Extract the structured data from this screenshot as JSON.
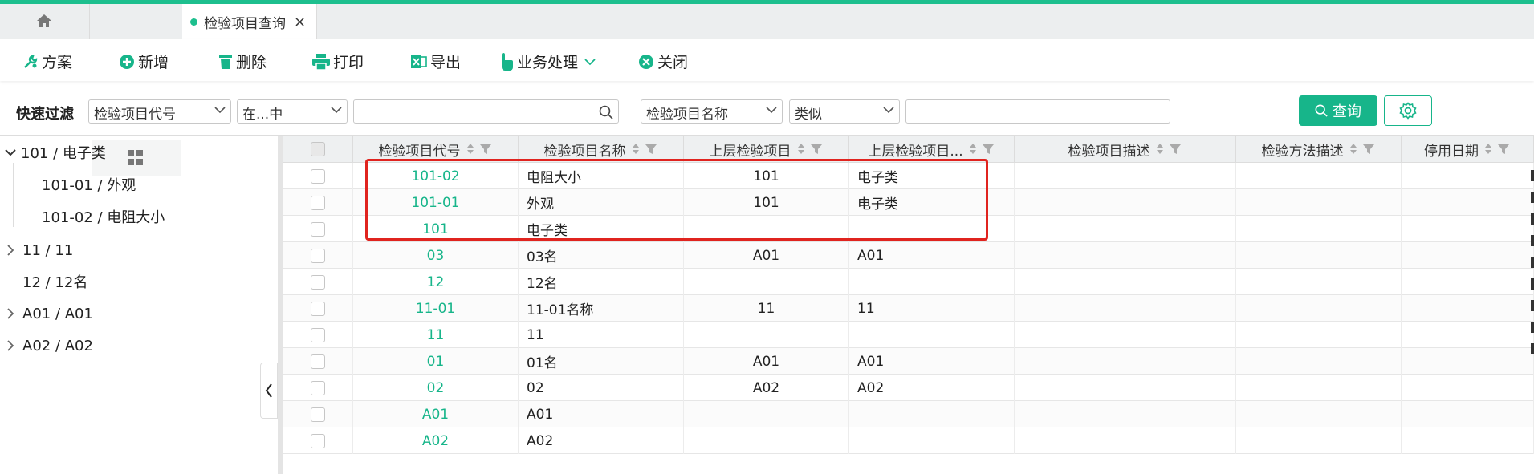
{
  "tabs": [
    {
      "name": "home",
      "label": ""
    },
    {
      "name": "apps",
      "label": ""
    },
    {
      "name": "query",
      "label": "检验项目查询",
      "close": "×"
    }
  ],
  "toolbar": {
    "scheme": "方案",
    "add": "新增",
    "delete": "删除",
    "print": "打印",
    "export": "导出",
    "business": "业务处理",
    "close": "关闭"
  },
  "filter": {
    "label": "快速过滤",
    "field1": "检验项目代号",
    "op1": "在...中",
    "value1": "",
    "field2": "检验项目名称",
    "op2": "类似",
    "value2": "",
    "query": "查询"
  },
  "tree": [
    {
      "label": "101 / 电子类",
      "expanded": true
    },
    {
      "label": "101-01 / 外观"
    },
    {
      "label": "101-02 / 电阻大小"
    },
    {
      "label": "11 / 11",
      "expanded": false
    },
    {
      "label": "12 / 12名"
    },
    {
      "label": "A01 / A01",
      "expanded": false
    },
    {
      "label": "A02 / A02",
      "expanded": false
    }
  ],
  "columns": [
    "检验项目代号",
    "检验项目名称",
    "上层检验项目",
    "上层检验项目...",
    "检验项目描述",
    "检验方法描述",
    "停用日期"
  ],
  "rows": [
    [
      "101-02",
      "电阻大小",
      "101",
      "电子类"
    ],
    [
      "101-01",
      "外观",
      "101",
      "电子类"
    ],
    [
      "101",
      "电子类",
      "",
      ""
    ],
    [
      "03",
      "03名",
      "A01",
      "A01"
    ],
    [
      "12",
      "12名",
      "",
      ""
    ],
    [
      "11-01",
      "11-01名称",
      "11",
      "11"
    ],
    [
      "11",
      "11",
      "",
      ""
    ],
    [
      "01",
      "01名",
      "A01",
      "A01"
    ],
    [
      "02",
      "02",
      "A02",
      "A02"
    ],
    [
      "A01",
      "A01",
      "",
      ""
    ],
    [
      "A02",
      "A02",
      "",
      ""
    ]
  ],
  "colors": {
    "accent": "#17b58a",
    "highlight": "#e0241f"
  }
}
